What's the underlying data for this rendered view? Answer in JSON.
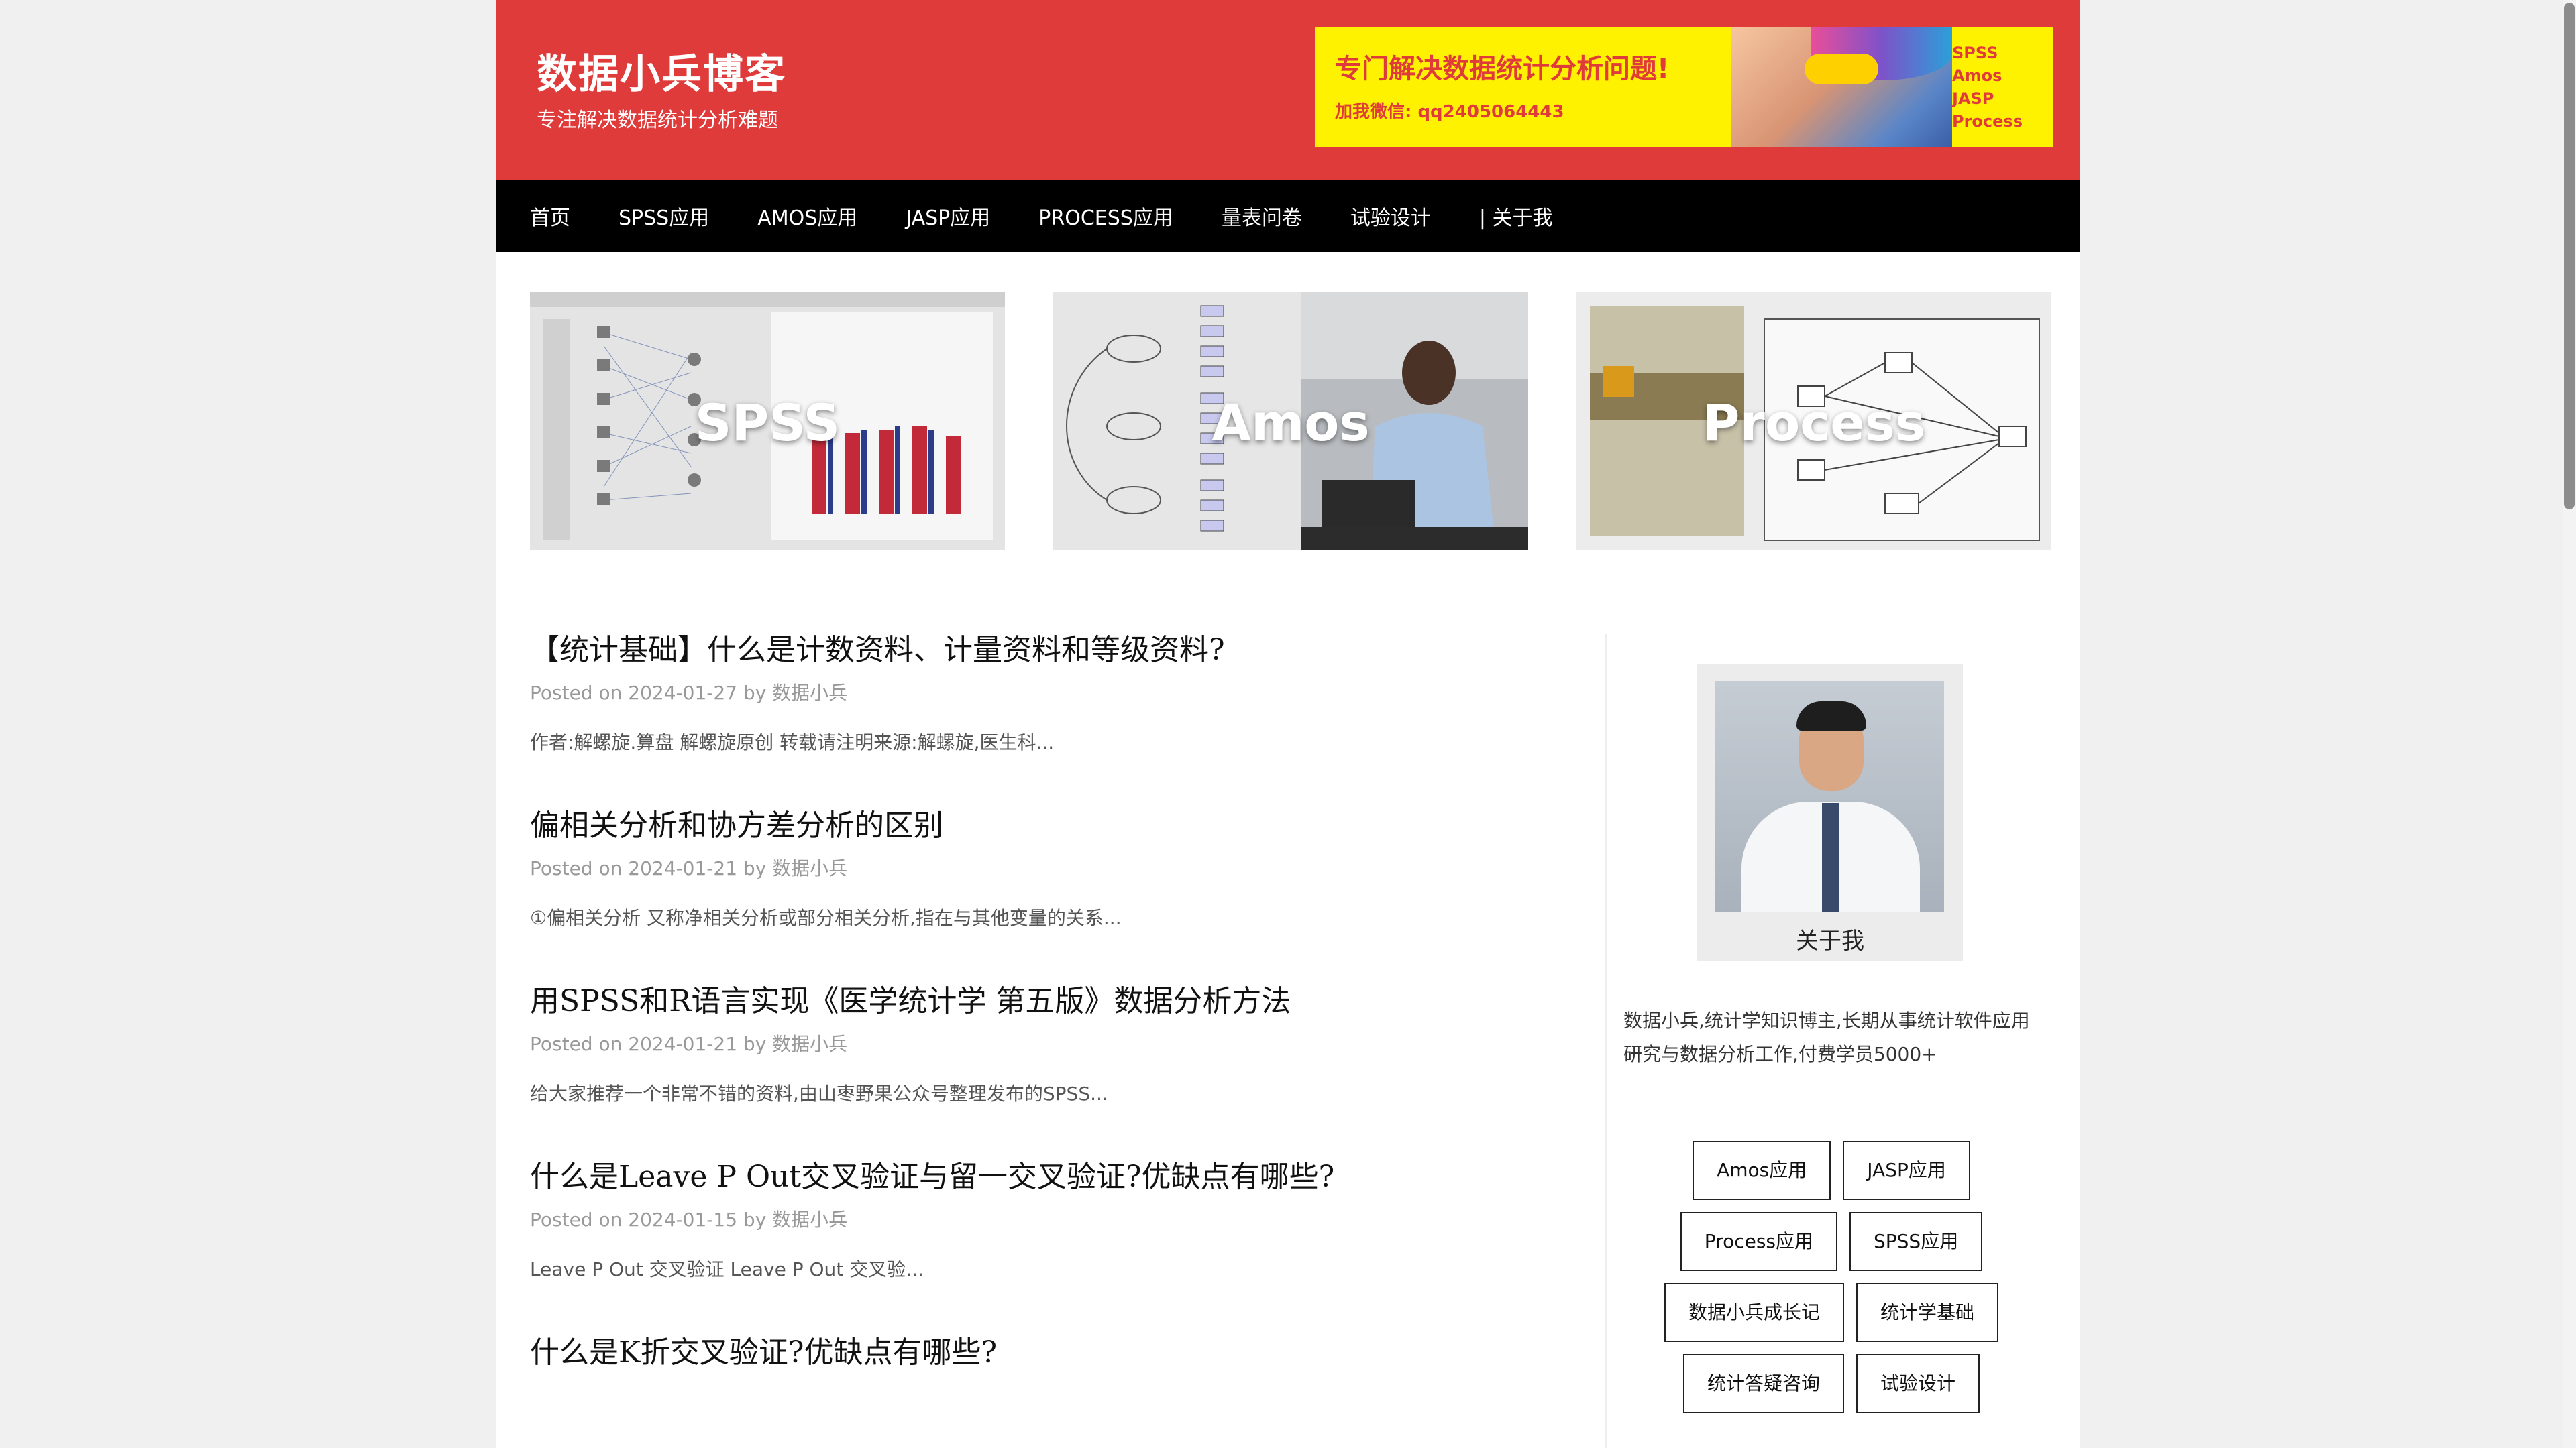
{
  "site": {
    "title": "数据小兵博客",
    "tagline": "专注解决数据统计分析难题"
  },
  "banner": {
    "headline": "专门解决数据统计分析问题!",
    "contact": "加我微信: qq2405064443",
    "tools": [
      "SPSS",
      "Amos",
      "JASP",
      "Process"
    ]
  },
  "nav": [
    "首页",
    "SPSS应用",
    "AMOS应用",
    "JASP应用",
    "PROCESS应用",
    "量表问卷",
    "试验设计",
    "| 关于我"
  ],
  "features": [
    {
      "label": "SPSS"
    },
    {
      "label": "Amos"
    },
    {
      "label": "Process"
    }
  ],
  "posts": [
    {
      "title": "【统计基础】什么是计数资料、计量资料和等级资料?",
      "posted_prefix": "Posted on",
      "date": "2024-01-27",
      "by": "by",
      "author": "数据小兵",
      "excerpt": "作者:解螺旋.算盘 解螺旋原创 转载请注明来源:解螺旋,医生科..."
    },
    {
      "title": "偏相关分析和协方差分析的区别",
      "posted_prefix": "Posted on",
      "date": "2024-01-21",
      "by": "by",
      "author": "数据小兵",
      "excerpt": "①偏相关分析 又称净相关分析或部分相关分析,指在与其他变量的关系..."
    },
    {
      "title": "用SPSS和R语言实现《医学统计学 第五版》数据分析方法",
      "posted_prefix": "Posted on",
      "date": "2024-01-21",
      "by": "by",
      "author": "数据小兵",
      "excerpt": "给大家推荐一个非常不错的资料,由山枣野果公众号整理发布的SPSS..."
    },
    {
      "title": "什么是Leave P Out交叉验证与留一交叉验证?优缺点有哪些?",
      "posted_prefix": "Posted on",
      "date": "2024-01-15",
      "by": "by",
      "author": "数据小兵",
      "excerpt": "Leave P Out 交叉验证 Leave P Out 交叉验..."
    },
    {
      "title": "什么是K折交叉验证?优缺点有哪些?",
      "posted_prefix": "",
      "date": "",
      "by": "",
      "author": "",
      "excerpt": ""
    }
  ],
  "sidebar": {
    "about_caption": "关于我",
    "about_text": "数据小兵,统计学知识博主,长期从事统计软件应用研究与数据分析工作,付费学员5000+",
    "tags": [
      [
        "Amos应用",
        "JASP应用"
      ],
      [
        "Process应用",
        "SPSS应用"
      ],
      [
        "数据小兵成长记",
        "统计学基础"
      ],
      [
        "统计答疑咨询",
        "试验设计"
      ]
    ]
  },
  "colors": {
    "header_red": "#e03b3b",
    "nav_black": "#000000",
    "banner_yellow": "#fff200"
  }
}
